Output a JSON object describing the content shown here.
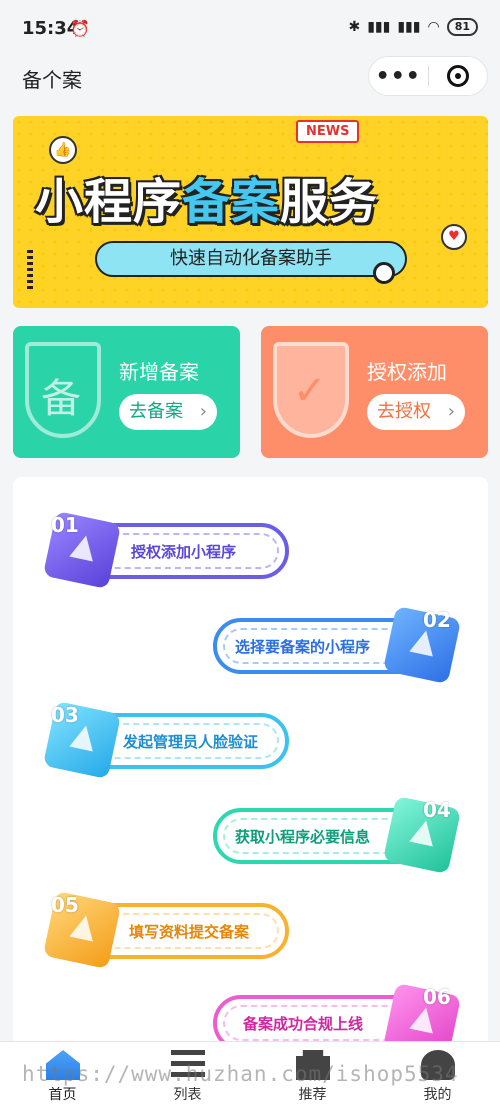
{
  "status_bar": {
    "time": "15:34",
    "battery": "81"
  },
  "navbar": {
    "title": "备个案",
    "more_label": "•••"
  },
  "banner": {
    "news": "NEWS",
    "title_part1": "小程序",
    "title_part2": "备案",
    "title_part3": "服务",
    "subtitle": "快速自动化备案助手"
  },
  "cards": [
    {
      "title": "新增备案",
      "button": "去备案",
      "icon_char": "备"
    },
    {
      "title": "授权添加",
      "button": "去授权"
    }
  ],
  "steps": [
    {
      "num": "01",
      "label": "授权添加小程序"
    },
    {
      "num": "02",
      "label": "选择要备案的小程序"
    },
    {
      "num": "03",
      "label": "发起管理员人脸验证"
    },
    {
      "num": "04",
      "label": "获取小程序必要信息"
    },
    {
      "num": "05",
      "label": "填写资料提交备案"
    },
    {
      "num": "06",
      "label": "备案成功合规上线"
    }
  ],
  "tabbar": [
    {
      "label": "首页",
      "icon": "home-icon",
      "active": true
    },
    {
      "label": "列表",
      "icon": "list-icon"
    },
    {
      "label": "推荐",
      "icon": "recommend-icon"
    },
    {
      "label": "我的",
      "icon": "profile-icon"
    }
  ],
  "watermark": "https://www.huzhan.com/ishop5534",
  "colors": {
    "banner": "#ffd325",
    "card_green": "#2ad3a8",
    "card_orange": "#fe8d69"
  }
}
